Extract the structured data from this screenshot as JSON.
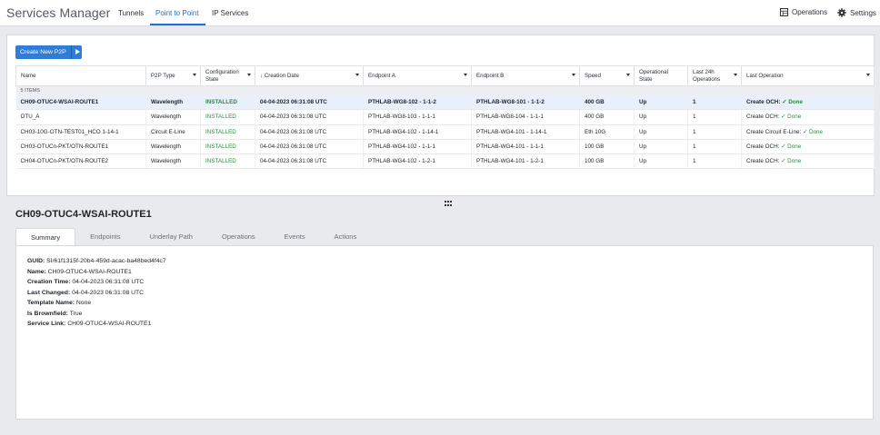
{
  "header": {
    "app_title": "Services Manager",
    "tabs": [
      {
        "label": "Tunnels"
      },
      {
        "label": "Point to Point"
      },
      {
        "label": "IP Services"
      }
    ],
    "operations_label": "Operations",
    "settings_label": "Settings",
    "accent_color": "#1f6fd0"
  },
  "toolbar": {
    "create_label": "Create New P2P"
  },
  "table": {
    "columns": [
      "Name",
      "P2P Type",
      "Configuration State",
      "↓ Creation Date",
      "Endpoint A",
      "Endpoint B",
      "Speed",
      "Operational State",
      "Last 24h Operations",
      "Last Operation"
    ],
    "count_label": "5 ITEMS",
    "rows": [
      {
        "name": "CH09-OTUC4-WSAI-ROUTE1",
        "type": "Wavelength",
        "state": "INSTALLED",
        "created": "04-04-2023 06:31:08 UTC",
        "a": "PTHLAB-WG8-102 - 1-1-2",
        "b": "PTHLAB-WG8-101 - 1-1-2",
        "speed": "400 GB",
        "op": "Up",
        "last24": "1",
        "lastop": "Create OCH:",
        "done": "✓ Done"
      },
      {
        "name": "OTU_A",
        "type": "Wavelength",
        "state": "INSTALLED",
        "created": "04-04-2023 06:31:08 UTC",
        "a": "PTHLAB-WG8-103 - 1-1-1",
        "b": "PTHLAB-WG8-104 - 1-1-1",
        "speed": "400 GB",
        "op": "Up",
        "last24": "1",
        "lastop": "Create OCH:",
        "done": "✓ Done"
      },
      {
        "name": "CH03-10G-OTN-TEST01_HCO 1-14-1",
        "type": "Circuit E-Line",
        "state": "INSTALLED",
        "created": "04-04-2023 06:31:08 UTC",
        "a": "PTHLAB-WG4-102 - 1-14-1",
        "b": "PTHLAB-WG4-101 - 1-14-1",
        "speed": "Eth 10G",
        "op": "Up",
        "last24": "1",
        "lastop": "Create Circuit E-Line:",
        "done": "✓ Done"
      },
      {
        "name": "CH03-OTUCn-PKT/OTN-ROUTE1",
        "type": "Wavelength",
        "state": "INSTALLED",
        "created": "04-04-2023 06:31:08 UTC",
        "a": "PTHLAB-WG4-102 - 1-1-1",
        "b": "PTHLAB-WG4-101 - 1-1-1",
        "speed": "100 GB",
        "op": "Up",
        "last24": "1",
        "lastop": "Create OCH:",
        "done": "✓ Done"
      },
      {
        "name": "CH04-OTUCn-PKT/OTN-ROUTE2",
        "type": "Wavelength",
        "state": "INSTALLED",
        "created": "04-04-2023 06:31:08 UTC",
        "a": "PTHLAB-WG4-102 - 1-2-1",
        "b": "PTHLAB-WG4-101 - 1-2-1",
        "speed": "100 GB",
        "op": "Up",
        "last24": "1",
        "lastop": "Create OCH:",
        "done": "✓ Done"
      }
    ]
  },
  "detail": {
    "title": "CH09-OTUC4-WSAI-ROUTE1",
    "tabs": [
      {
        "label": "Summary"
      },
      {
        "label": "Endpoints"
      },
      {
        "label": "Underlay Path"
      },
      {
        "label": "Operations"
      },
      {
        "label": "Events"
      },
      {
        "label": "Actions"
      }
    ],
    "props": [
      {
        "key": "GUID:",
        "value": "SI/61f1315f-20b4-459d-acac-ba48bed4f4c7"
      },
      {
        "key": "Name:",
        "value": "CH09-OTUC4-WSAI-ROUTE1"
      },
      {
        "key": "Creation Time:",
        "value": "04-04-2023 06:31:08 UTC"
      },
      {
        "key": "Last Changed:",
        "value": "04-04-2023 06:31:08 UTC"
      },
      {
        "key": "Template Name:",
        "value": "None"
      },
      {
        "key": "Is Brownfield:",
        "value": "True"
      },
      {
        "key": "Service Link:",
        "value": "CH09-OTUC4-WSAI-ROUTE1"
      }
    ]
  }
}
